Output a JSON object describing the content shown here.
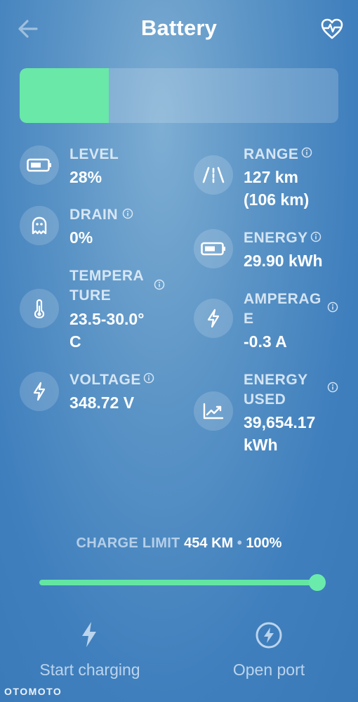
{
  "header": {
    "title": "Battery",
    "back_icon": "arrow-left-icon",
    "health_icon": "heart-pulse-icon"
  },
  "battery": {
    "level_fraction": 0.28,
    "fill_color": "#69e8a8"
  },
  "stats": {
    "level": {
      "label": "LEVEL",
      "value": "28%",
      "icon": "battery-icon"
    },
    "drain": {
      "label": "DRAIN",
      "value": "0%",
      "icon": "ghost-icon"
    },
    "temperature": {
      "label_line1": "TEMPERA",
      "label_line2": "TURE",
      "value_line1": "23.5-30.0°",
      "value_line2": "C",
      "icon": "thermometer-icon"
    },
    "voltage": {
      "label": "VOLTAGE",
      "value": "348.72 V",
      "icon": "lightning-icon"
    },
    "range": {
      "label": "RANGE",
      "value_line1": "127 km",
      "value_line2": "(106 km)",
      "icon": "road-icon"
    },
    "energy": {
      "label": "ENERGY",
      "value": "29.90 kWh",
      "icon": "battery-icon"
    },
    "amperage": {
      "label_line1": "AMPERAG",
      "label_line2": "E",
      "value": "-0.3 A",
      "icon": "lightning-icon"
    },
    "energy_used": {
      "label_line1": "ENERGY",
      "label_line2": "USED",
      "value_line1": "39,654.17",
      "value_line2": "kWh",
      "icon": "chart-trend-icon"
    }
  },
  "charge_limit": {
    "label": "CHARGE LIMIT",
    "distance": "454 KM",
    "separator": "•",
    "percent": "100%",
    "slider_fraction": 1.0
  },
  "actions": {
    "start_charging": {
      "label": "Start charging",
      "icon": "lightning-icon"
    },
    "open_port": {
      "label": "Open port",
      "icon": "lightning-circle-icon"
    }
  },
  "watermark": "OTOMOTO"
}
